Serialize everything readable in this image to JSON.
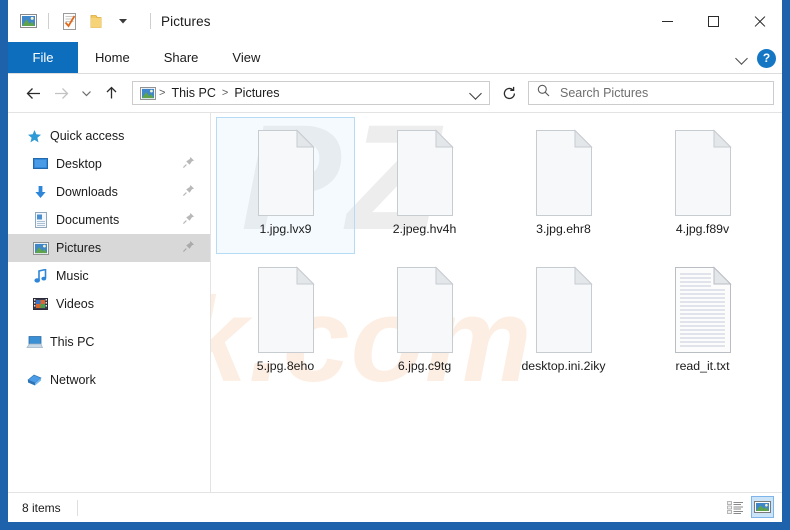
{
  "window": {
    "title": "Pictures",
    "quick_access_toolbar": [
      {
        "name": "pictures-folder-icon",
        "label": "Pictures"
      },
      {
        "name": "properties-icon",
        "label": "Properties"
      },
      {
        "name": "new-folder-icon",
        "label": "New folder"
      },
      {
        "name": "customize-chevron-icon",
        "label": "Customize Quick Access Toolbar"
      }
    ],
    "controls": {
      "minimize": "Minimize",
      "maximize": "Maximize",
      "close": "Close"
    }
  },
  "ribbon": {
    "tabs": [
      {
        "label": "File",
        "active": true
      },
      {
        "label": "Home",
        "active": false
      },
      {
        "label": "Share",
        "active": false
      },
      {
        "label": "View",
        "active": false
      }
    ],
    "expand_label": "Expand the Ribbon",
    "help_label": "?"
  },
  "address_bar": {
    "back": "Back",
    "forward": "Forward",
    "recent": "Recent locations",
    "up": "Up",
    "breadcrumb": [
      "This PC",
      "Pictures"
    ],
    "crumb_separator": ">",
    "dropdown": "Previous locations",
    "refresh": "Refresh"
  },
  "search": {
    "placeholder": "Search Pictures",
    "icon": "search-icon"
  },
  "sidebar": {
    "items": [
      {
        "label": "Quick access",
        "icon": "star-icon",
        "pinned": false,
        "selected": false,
        "root": true
      },
      {
        "label": "Desktop",
        "icon": "desktop-icon",
        "pinned": true,
        "selected": false,
        "root": false
      },
      {
        "label": "Downloads",
        "icon": "downloads-icon",
        "pinned": true,
        "selected": false,
        "root": false
      },
      {
        "label": "Documents",
        "icon": "documents-icon",
        "pinned": true,
        "selected": false,
        "root": false
      },
      {
        "label": "Pictures",
        "icon": "pictures-icon",
        "pinned": true,
        "selected": true,
        "root": false
      },
      {
        "label": "Music",
        "icon": "music-icon",
        "pinned": false,
        "selected": false,
        "root": false
      },
      {
        "label": "Videos",
        "icon": "videos-icon",
        "pinned": false,
        "selected": false,
        "root": false
      },
      {
        "label": "This PC",
        "icon": "this-pc-icon",
        "pinned": false,
        "selected": false,
        "root": true
      },
      {
        "label": "Network",
        "icon": "network-icon",
        "pinned": false,
        "selected": false,
        "root": true
      }
    ]
  },
  "files": [
    {
      "name": "1.jpg.lvx9",
      "icon": "blank-file-icon",
      "selected": true
    },
    {
      "name": "2.jpeg.hv4h",
      "icon": "blank-file-icon",
      "selected": false
    },
    {
      "name": "3.jpg.ehr8",
      "icon": "blank-file-icon",
      "selected": false
    },
    {
      "name": "4.jpg.f89v",
      "icon": "blank-file-icon",
      "selected": false
    },
    {
      "name": "5.jpg.8eho",
      "icon": "blank-file-icon",
      "selected": false
    },
    {
      "name": "6.jpg.c9tg",
      "icon": "blank-file-icon",
      "selected": false
    },
    {
      "name": "desktop.ini.2iky",
      "icon": "blank-file-icon",
      "selected": false
    },
    {
      "name": "read_it.txt",
      "icon": "text-file-icon",
      "selected": false
    }
  ],
  "status_bar": {
    "item_count": "8 items",
    "views": [
      {
        "name": "details-view-button",
        "label": "Details view",
        "active": false
      },
      {
        "name": "large-icons-view-button",
        "label": "Large icons view",
        "active": true
      }
    ]
  },
  "watermarks": {
    "gray": "PZ",
    "orange": "risk.com"
  },
  "colors": {
    "accent": "#0d6ebd",
    "desktop": "#1d62ab",
    "selection_border": "#b6dcf5",
    "sidebar_selected": "#d8d8d8"
  }
}
